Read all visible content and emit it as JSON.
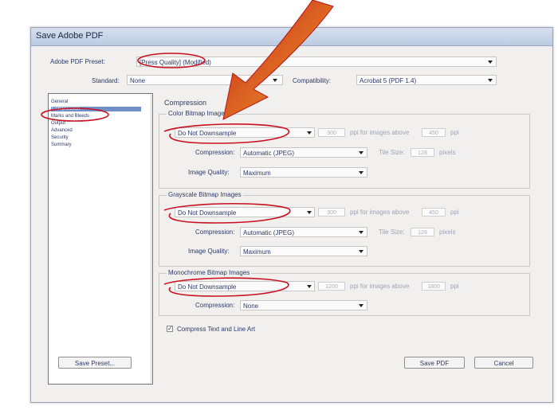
{
  "window": {
    "title": "Save Adobe PDF"
  },
  "preset": {
    "label": "Adobe PDF Preset:",
    "value": "[Press Quality] (Modified)"
  },
  "standard": {
    "label": "Standard:",
    "value": "None"
  },
  "compatibility": {
    "label": "Compatibility:",
    "value": "Acrobat 5 (PDF 1.4)"
  },
  "sidebar": {
    "items": [
      {
        "label": "General"
      },
      {
        "label": "Compression"
      },
      {
        "label": "Marks and Bleeds"
      },
      {
        "label": "Output"
      },
      {
        "label": "Advanced"
      },
      {
        "label": "Security"
      },
      {
        "label": "Summary"
      }
    ],
    "selected": "Compression"
  },
  "section_title": "Compression",
  "color_images": {
    "title": "Color Bitmap Images",
    "downsample": "Do Not Downsample",
    "ppi": "300",
    "above_text": "ppi for images above",
    "above_value": "450",
    "above_unit": "ppi",
    "compression_label": "Compression:",
    "compression": "Automatic (JPEG)",
    "tile_label": "Tile Size:",
    "tile": "128",
    "tile_unit": "pixels",
    "quality_label": "Image Quality:",
    "quality": "Maximum"
  },
  "grayscale_images": {
    "title": "Grayscale Bitmap Images",
    "downsample": "Do Not Downsample",
    "ppi": "300",
    "above_text": "ppi for images above",
    "above_value": "450",
    "above_unit": "ppi",
    "compression_label": "Compression:",
    "compression": "Automatic (JPEG)",
    "tile_label": "Tile Size:",
    "tile": "128",
    "tile_unit": "pixels",
    "quality_label": "Image Quality:",
    "quality": "Maximum"
  },
  "mono_images": {
    "title": "Monochrome Bitmap Images",
    "downsample": "Do Not Downsample",
    "ppi": "1200",
    "above_text": "ppi for images above",
    "above_value": "1800",
    "above_unit": "ppi",
    "compression_label": "Compression:",
    "compression": "None"
  },
  "compress_text": {
    "label": "Compress Text and Line Art",
    "checked": true
  },
  "buttons": {
    "save_preset": "Save Preset...",
    "save_pdf": "Save PDF",
    "cancel": "Cancel"
  },
  "colors": {
    "annotation": "#c8101e",
    "arrow_start": "#e8a020",
    "arrow_end": "#d0281a",
    "selection": "#6f8fc7"
  }
}
